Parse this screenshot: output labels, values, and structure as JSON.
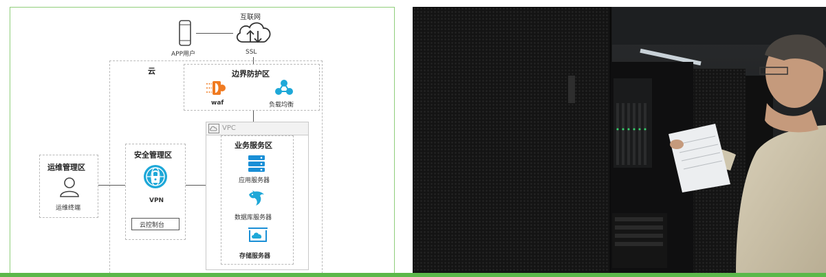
{
  "diagram": {
    "internet": "互联网",
    "app_user": "APP用户",
    "ssl": "SSL",
    "cloud": "云",
    "border_zone": "边界防护区",
    "waf": "waf",
    "load_balancer": "负载均衡",
    "vpc": "VPC",
    "business_zone": "业务服务区",
    "app_server": "应用服务器",
    "db_server": "数据库服务器",
    "storage_server": "存储服务器",
    "security_zone": "安全管理区",
    "vpn": "VPN",
    "console": "云控制台",
    "ops_zone": "运维管理区",
    "ops_terminal": "运维终端"
  },
  "colors": {
    "accent_green": "#5bb84a",
    "icon_blue": "#1a8fd6",
    "icon_orange": "#f07b22",
    "icon_teal": "#1ea8d8"
  },
  "icons": {
    "phone": "phone-icon",
    "cloud": "cloud-upload-download-icon",
    "waf": "firewall-icon",
    "lb": "load-balancer-icon",
    "vpc": "cloud-small-icon",
    "server": "server-stack-icon",
    "database": "dolphin-database-icon",
    "storage": "storage-cloud-icon",
    "vpn": "lock-globe-icon",
    "user": "user-icon"
  }
}
